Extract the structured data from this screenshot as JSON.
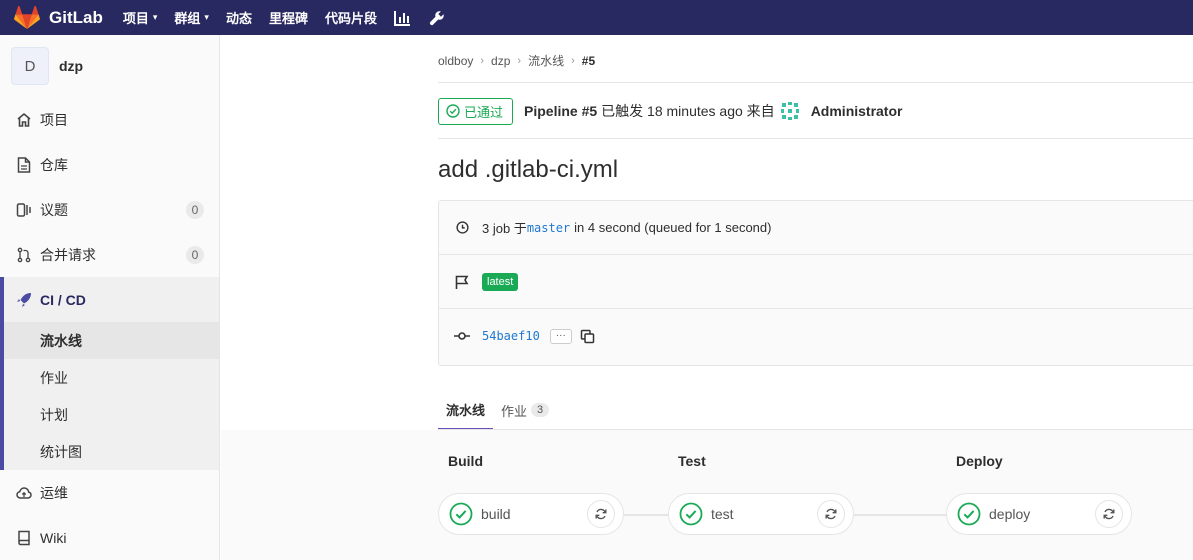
{
  "topbar": {
    "brand": "GitLab",
    "nav": [
      {
        "label": "项目",
        "caret": "▾"
      },
      {
        "label": "群组",
        "caret": "▾"
      },
      {
        "label": "动态",
        "caret": ""
      },
      {
        "label": "里程碑",
        "caret": ""
      },
      {
        "label": "代码片段",
        "caret": ""
      }
    ]
  },
  "sidebar": {
    "project_initial": "D",
    "project_name": "dzp",
    "items": [
      {
        "label": "项目",
        "badge": null
      },
      {
        "label": "仓库",
        "badge": null
      },
      {
        "label": "议题",
        "badge": "0"
      },
      {
        "label": "合并请求",
        "badge": "0"
      }
    ],
    "cicd": {
      "label": "CI / CD",
      "subitems": [
        "流水线",
        "作业",
        "计划",
        "统计图"
      ]
    },
    "after": [
      {
        "label": "运维"
      },
      {
        "label": "Wiki"
      }
    ]
  },
  "breadcrumb": [
    "oldboy",
    "dzp",
    "流水线",
    "#5"
  ],
  "header": {
    "status": "已通过",
    "pipeline": "Pipeline #5",
    "triggered": "已触发 18 minutes ago 来自",
    "user": "Administrator"
  },
  "commit_title": "add .gitlab-ci.yml",
  "info": {
    "jobs_prefix": "3 job 于",
    "branch": "master",
    "jobs_suffix": "in 4 second (queued for 1 second)",
    "tag": "latest",
    "sha": "54baef10",
    "ellipsis": "···"
  },
  "tabs": [
    {
      "label": "流水线",
      "count": null
    },
    {
      "label": "作业",
      "count": "3"
    }
  ],
  "stages": [
    {
      "title": "Build",
      "job": "build"
    },
    {
      "title": "Test",
      "job": "test"
    },
    {
      "title": "Deploy",
      "job": "deploy"
    }
  ],
  "colors": {
    "topbar": "#292961",
    "success": "#1aaa55",
    "link": "#1f78d1"
  }
}
